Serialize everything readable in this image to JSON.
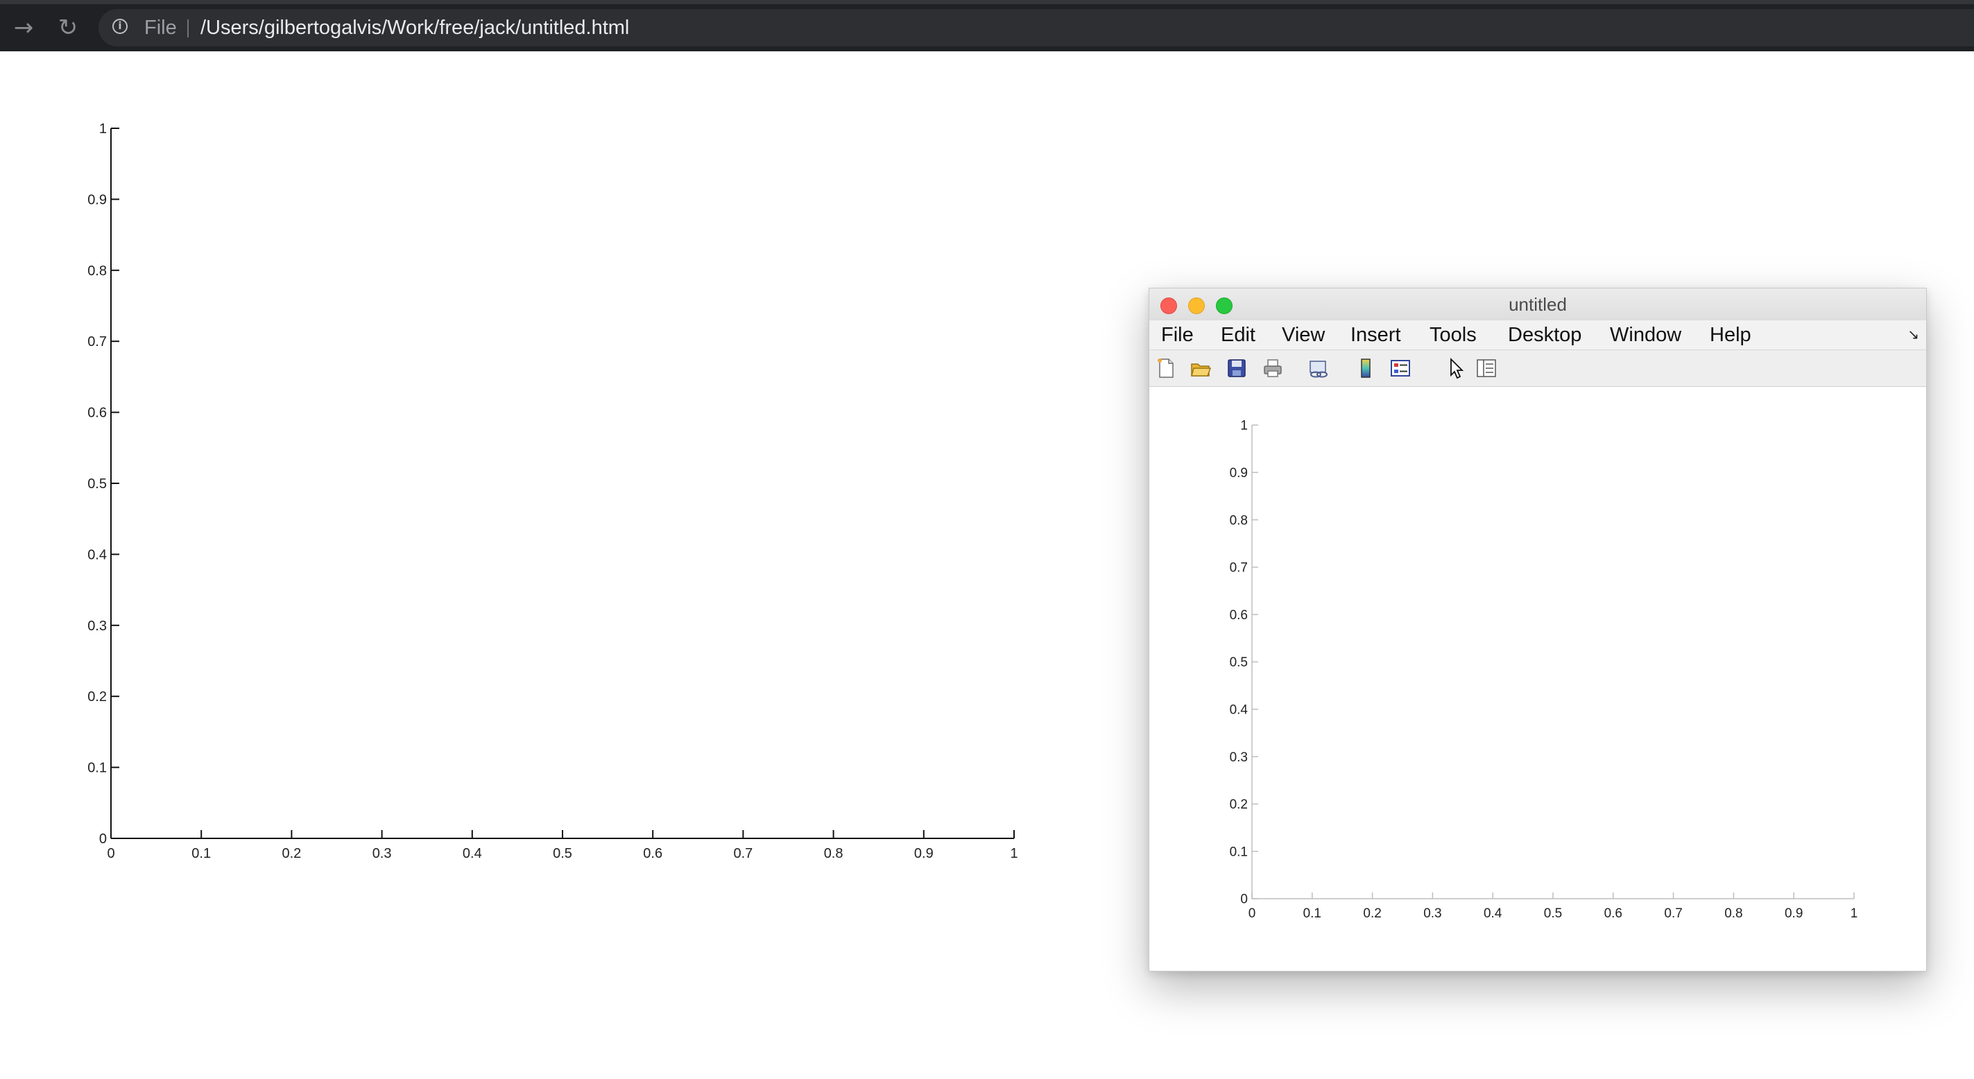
{
  "browser": {
    "scheme_label": "File",
    "url": "/Users/gilbertogalvis/Work/free/jack/untitled.html"
  },
  "figure_window": {
    "title": "untitled",
    "menu": [
      "File",
      "Edit",
      "View",
      "Insert",
      "Tools",
      "Desktop",
      "Window",
      "Help"
    ],
    "toolbar_icons": [
      "new-figure-icon",
      "open-file-icon",
      "save-icon",
      "print-icon",
      "link-plot-icon",
      "colorbar-icon",
      "legend-icon",
      "pointer-icon",
      "property-inspector-icon"
    ]
  },
  "chart_data": [
    {
      "type": "line",
      "series": [],
      "xlim": [
        0,
        1
      ],
      "ylim": [
        0,
        1
      ],
      "xticks": [
        "0",
        "0.1",
        "0.2",
        "0.3",
        "0.4",
        "0.5",
        "0.6",
        "0.7",
        "0.8",
        "0.9",
        "1"
      ],
      "yticks": [
        "0",
        "0.1",
        "0.2",
        "0.3",
        "0.4",
        "0.5",
        "0.6",
        "0.7",
        "0.8",
        "0.9",
        "1"
      ],
      "grid": false
    },
    {
      "type": "line",
      "series": [],
      "xlim": [
        0,
        1
      ],
      "ylim": [
        0,
        1
      ],
      "xticks": [
        "0",
        "0.1",
        "0.2",
        "0.3",
        "0.4",
        "0.5",
        "0.6",
        "0.7",
        "0.8",
        "0.9",
        "1"
      ],
      "yticks": [
        "0",
        "0.1",
        "0.2",
        "0.3",
        "0.4",
        "0.5",
        "0.6",
        "0.7",
        "0.8",
        "0.9",
        "1"
      ],
      "grid": false
    }
  ]
}
